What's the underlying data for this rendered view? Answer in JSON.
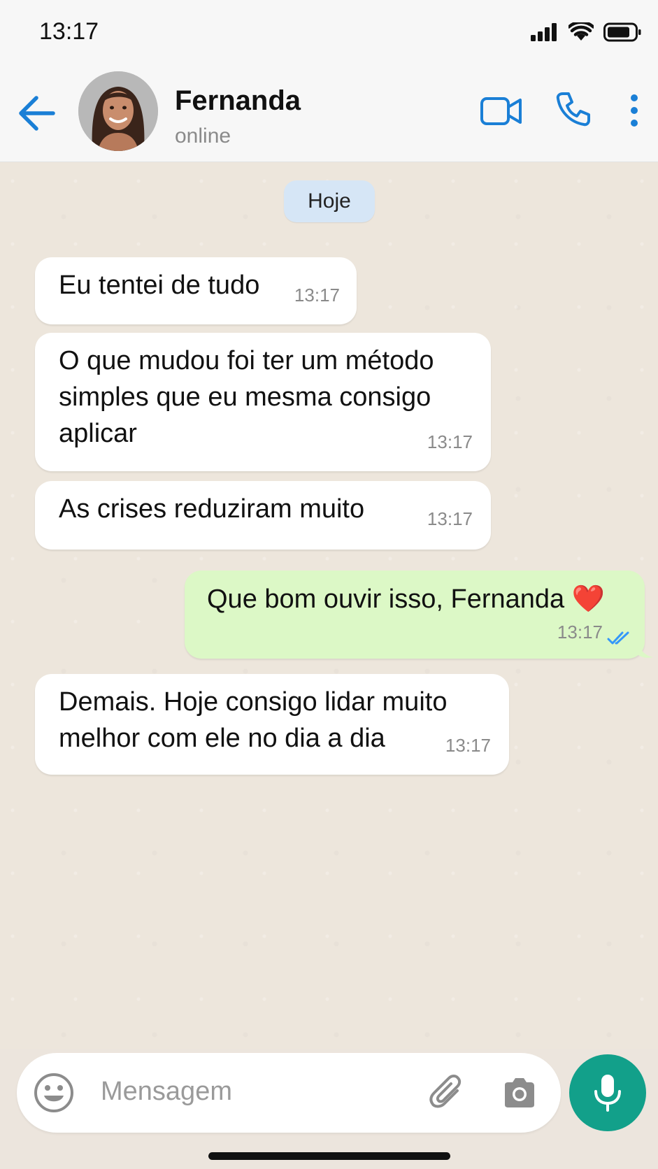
{
  "status_bar": {
    "time": "13:17"
  },
  "header": {
    "contact_name": "Fernanda",
    "contact_status": "online"
  },
  "chat": {
    "date_label": "Hoje",
    "messages": [
      {
        "direction": "in",
        "lines": [
          "Eu tentei de tudo"
        ],
        "time": "13:17"
      },
      {
        "direction": "in",
        "lines": [
          "O que mudou foi ter um método",
          "simples que eu mesma consigo",
          "aplicar"
        ],
        "time": "13:17"
      },
      {
        "direction": "in",
        "lines": [
          "As crises reduziram muito"
        ],
        "time": "13:17"
      },
      {
        "direction": "out",
        "lines": [
          "Que bom ouvir isso, Fernanda"
        ],
        "emoji": "❤️",
        "time": "13:17",
        "read": true
      },
      {
        "direction": "in",
        "lines": [
          "Demais. Hoje consigo lidar muito",
          "melhor com ele no dia a dia"
        ],
        "time": "13:17"
      }
    ]
  },
  "input": {
    "placeholder": "Mensagem"
  },
  "colors": {
    "accent": "#1a7fd6",
    "outgoing_bubble": "#dcf8c6",
    "mic_button": "#12a08a",
    "read_ticks": "#3497f9"
  },
  "icons": [
    "back-arrow-icon",
    "video-call-icon",
    "voice-call-icon",
    "more-options-icon",
    "emoji-icon",
    "attach-icon",
    "camera-icon",
    "mic-icon",
    "signal-icon",
    "wifi-icon",
    "battery-icon"
  ]
}
